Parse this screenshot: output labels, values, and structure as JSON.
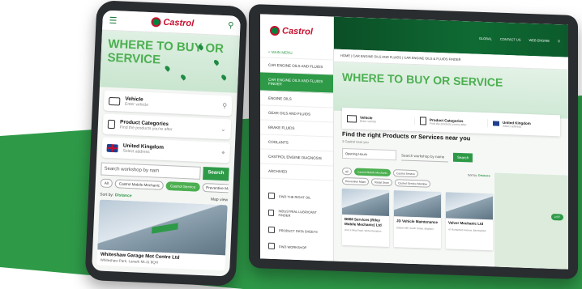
{
  "colors": {
    "brand_green": "#2e9a48",
    "title_green": "#4caf50",
    "brand_red": "#c8102e",
    "dark_green": "#0b4e26"
  },
  "phone": {
    "logo": "Castrol",
    "title_line1": "WHERE TO BUY OR",
    "title_line2": "SERVICE",
    "vehicle": {
      "title": "Vehicle",
      "sub": "Enter vehicle"
    },
    "products": {
      "title": "Product Categories",
      "sub": "Find the products you're after"
    },
    "location": {
      "title": "United Kingdom",
      "sub": "Select address"
    },
    "search_placeholder": "Search workshop by nam",
    "search_button": "Search",
    "chips": [
      "All",
      "Castrol Mobile Mechanic",
      "Castrol Service",
      "Preventive Maint"
    ],
    "sort_label": "Sort by:",
    "sort_value": "Distance",
    "map_view": "Map view",
    "result": {
      "name": "Whiteshaw Garage Mot Centre Ltd",
      "address": "Whiteshaw Park, Lanark ML11 8QH"
    }
  },
  "tablet": {
    "logo": "Castrol",
    "header_links": [
      "GLOBAL",
      "CONTACT US",
      "WEB ENGINE"
    ],
    "back": "< MAIN MENU",
    "nav": [
      "CAR ENGINE OILS AND FLUIDS",
      "CAR ENGINE OILS AND FLUIDS FINDER",
      "ENGINE OILS",
      "GEAR OILS AND FLUIDS",
      "BRAKE FLUIDS",
      "COOLANTS",
      "CASTROL ENGINE DIAGNOSIS",
      "ARCHIVED"
    ],
    "nav_active_index": 1,
    "tools": [
      "FIND THE RIGHT OIL",
      "INDUSTRIAL LUBRICANT FINDER",
      "PRODUCT DATA SHEETS",
      "FIND WORKSHOP"
    ],
    "breadcrumb": "HOME | CAR ENGINE OILS AND FLUIDS | CAR ENGINE OILS & FLUIDS FINDER",
    "title": "WHERE TO BUY OR SERVICE",
    "filters": [
      {
        "title": "Vehicle",
        "sub": "Enter vehicle"
      },
      {
        "title": "Product Categories",
        "sub": "Find the products you're after"
      },
      {
        "title": "United Kingdom",
        "sub": "Select address"
      }
    ],
    "find_title": "Find the right Products or Services near you",
    "find_sub": "3 Castrol near you",
    "select_value": "Opening Hours",
    "search_placeholder": "Search workshop by name",
    "search_button": "Search",
    "chips": [
      "All",
      "Castrol Mobile Mechanic",
      "Castrol Service",
      "Preventive Maint",
      "Retail Store",
      "Castrol Service Member"
    ],
    "sort_label": "Sort by:",
    "sort_value": "Distance",
    "cards": [
      {
        "name": "BMM Services (Riley Mobile Mechanic) Ltd",
        "line": "Unit 3 Ring Road, Wolverhampton"
      },
      {
        "name": "JD Vehicle Maintenance",
        "line": "Station Mill, South Street, Brighton"
      },
      {
        "name": "Valver Mechanic Ltd",
        "line": "47 Rutherford Avenue, Birmingham"
      }
    ],
    "map_button": "LIST"
  }
}
